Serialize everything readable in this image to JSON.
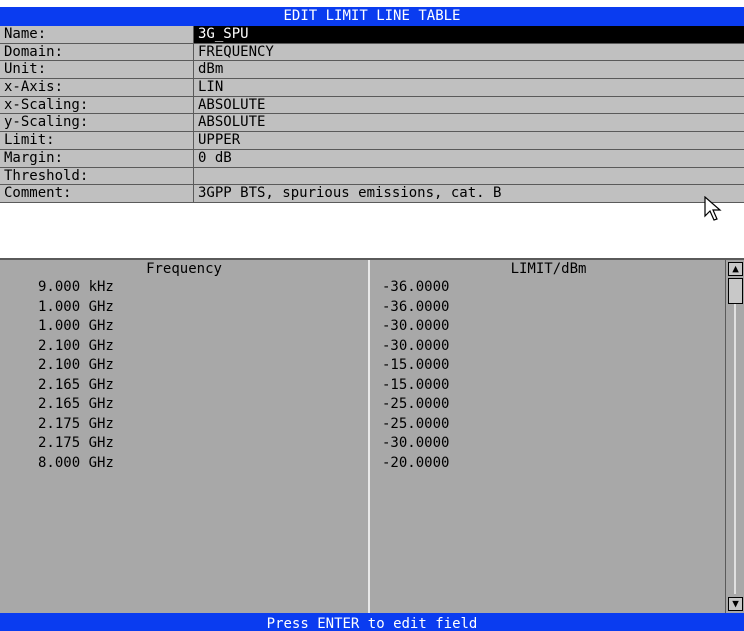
{
  "window": {
    "title": "EDIT LIMIT LINE TABLE"
  },
  "properties": [
    {
      "label": "Name:",
      "value": "3G_SPU",
      "selected": true
    },
    {
      "label": "Domain:",
      "value": "FREQUENCY"
    },
    {
      "label": "Unit:",
      "value": "dBm"
    },
    {
      "label": "x-Axis:",
      "value": "LIN"
    },
    {
      "label": "x-Scaling:",
      "value": "ABSOLUTE"
    },
    {
      "label": "y-Scaling:",
      "value": "ABSOLUTE"
    },
    {
      "label": "Limit:",
      "value": "UPPER"
    },
    {
      "label": "Margin:",
      "value": "0 dB"
    },
    {
      "label": "Threshold:",
      "value": ""
    },
    {
      "label": "Comment:",
      "value": "3GPP BTS, spurious emissions, cat. B"
    }
  ],
  "table": {
    "headers": {
      "frequency": "Frequency",
      "limit": "LIMIT/dBm"
    },
    "rows": [
      {
        "frequency": "9.000 kHz",
        "limit": "-36.0000"
      },
      {
        "frequency": "1.000 GHz",
        "limit": "-36.0000"
      },
      {
        "frequency": "1.000 GHz",
        "limit": "-30.0000"
      },
      {
        "frequency": "2.100 GHz",
        "limit": "-30.0000"
      },
      {
        "frequency": "2.100 GHz",
        "limit": "-15.0000"
      },
      {
        "frequency": "2.165 GHz",
        "limit": "-15.0000"
      },
      {
        "frequency": "2.165 GHz",
        "limit": "-25.0000"
      },
      {
        "frequency": "2.175 GHz",
        "limit": "-25.0000"
      },
      {
        "frequency": "2.175 GHz",
        "limit": "-30.0000"
      },
      {
        "frequency": "8.000 GHz",
        "limit": "-20.0000"
      }
    ]
  },
  "status": {
    "message": "Press ENTER to edit field"
  },
  "icons": {
    "scroll_up": "arrow-up-icon",
    "scroll_down": "arrow-down-icon",
    "cursor": "mouse-pointer-icon"
  },
  "colors": {
    "title_bar": "#0a3cf0",
    "panel": "#c0c0c0",
    "table": "#a8a8a8",
    "selected": "#000000"
  }
}
